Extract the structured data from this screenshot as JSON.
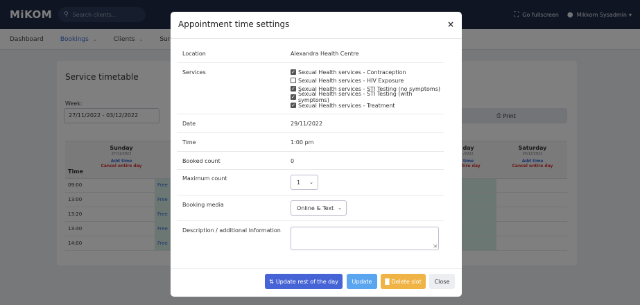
{
  "app": {
    "logo": "MiKOM",
    "search_placeholder": "Search clients...",
    "fullscreen": "Go fullscreen",
    "user": "Mikkom Sysadmin"
  },
  "nav": [
    "Dashboard",
    "Bookings",
    "Clients",
    "Surv"
  ],
  "timetable": {
    "title": "Service timetable",
    "week_label": "Week:",
    "week_value": "27/11/2022 - 03/12/2022",
    "print": "Print",
    "time_header": "Time",
    "days": [
      {
        "name": "Sunday",
        "date": "27/11/2022",
        "add": "Add time",
        "cancel": "Cancel entire day"
      },
      {
        "name": "day",
        "date": "/2022",
        "add": "time",
        "cancel": "entire day"
      },
      {
        "name": "Saturday",
        "date": "03/12/2022",
        "add": "Add time",
        "cancel": "Cancel entire day"
      }
    ],
    "times": [
      "09:00",
      "13:00",
      "13:20",
      "13:40",
      "14:00"
    ],
    "free": "Free"
  },
  "modal": {
    "title": "Appointment time settings",
    "close_icon": "×",
    "location_label": "Location",
    "location_value": "Alexandra Health Centre",
    "services_label": "Services",
    "services": [
      {
        "label": "Sexual Health services - Contraception",
        "checked": true
      },
      {
        "label": "Sexual Health services - HIV Exposure",
        "checked": false
      },
      {
        "label": "Sexual Health services - STI Testing (no symptoms)",
        "checked": true
      },
      {
        "label": "Sexual Health services - STI Testing (with symptoms)",
        "checked": true
      },
      {
        "label": "Sexual Health services - Treatment",
        "checked": true
      }
    ],
    "date_label": "Date",
    "date_value": "29/11/2022",
    "time_label": "Time",
    "time_value": "1:00 pm",
    "booked_label": "Booked count",
    "booked_value": "0",
    "max_label": "Maximum count",
    "max_value": "1",
    "media_label": "Booking media",
    "media_value": "Online & Text",
    "desc_label": "Description / additional information",
    "desc_value": "",
    "buttons": {
      "update_rest": "Update rest of the day",
      "update": "Update",
      "delete": "Delete slot",
      "close": "Close"
    }
  }
}
